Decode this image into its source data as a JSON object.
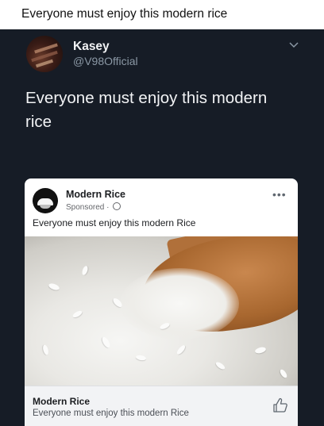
{
  "caption": {
    "text": "Everyone must enjoy this modern rice"
  },
  "tweet": {
    "display_name": "Kasey",
    "handle": "@V98Official",
    "body": "Everyone must enjoy this modern rice"
  },
  "ad": {
    "page_name": "Modern Rice",
    "sponsored": "Sponsored ·",
    "more": "•••",
    "text": "Everyone must enjoy this modern Rice",
    "footer_title": "Modern Rice",
    "footer_subtitle": "Everyone must enjoy this modern Rice"
  },
  "icons": [
    "chevron-down-icon",
    "globe-icon",
    "more-icon",
    "thumbs-up-icon"
  ],
  "colors": {
    "tweet_bg": "#161c26",
    "name": "#f2f3f5",
    "handle": "#8b98a5",
    "card_bg": "#ffffff",
    "footer_bg": "#f2f3f5"
  }
}
